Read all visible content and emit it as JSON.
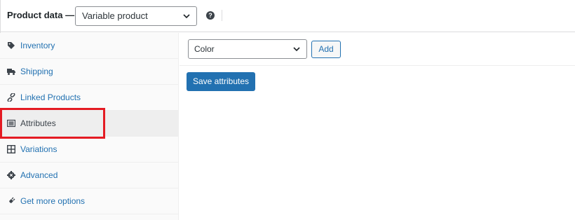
{
  "header": {
    "label": "Product data —",
    "product_type": "Variable product",
    "help_symbol": "?"
  },
  "sidebar": {
    "items": [
      {
        "label": "Inventory",
        "icon": "tag-icon"
      },
      {
        "label": "Shipping",
        "icon": "truck-icon"
      },
      {
        "label": "Linked Products",
        "icon": "link-icon"
      },
      {
        "label": "Attributes",
        "icon": "list-icon",
        "active": true
      },
      {
        "label": "Variations",
        "icon": "grid-icon"
      },
      {
        "label": "Advanced",
        "icon": "gear-icon"
      },
      {
        "label": "Get more options",
        "icon": "plugin-icon"
      }
    ]
  },
  "attributes_panel": {
    "attribute_select_value": "Color",
    "add_label": "Add",
    "save_label": "Save attributes"
  },
  "colors": {
    "accent": "#2271b1",
    "highlight_box": "#e41b23",
    "active_tab_bg": "#eeeeee"
  }
}
